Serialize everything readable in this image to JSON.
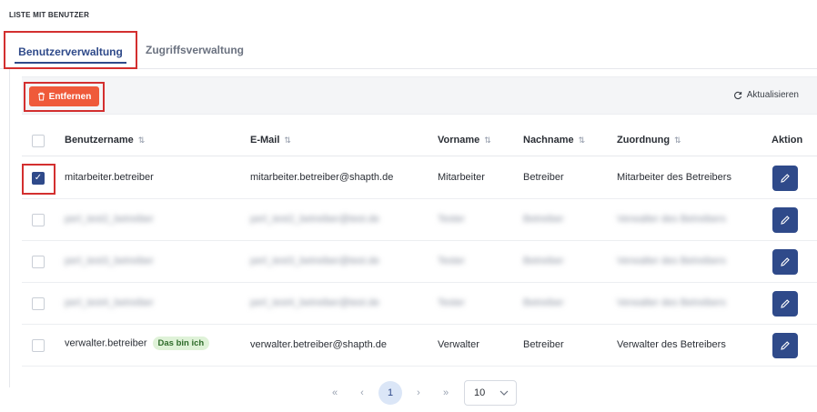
{
  "page_title": "LISTE MIT BENUTZER",
  "tabs": [
    {
      "label": "Benutzerverwaltung",
      "active": true
    },
    {
      "label": "Zugriffsverwaltung",
      "active": false
    }
  ],
  "toolbar": {
    "remove_label": "Entfernen",
    "refresh_label": "Aktualisieren"
  },
  "table": {
    "headers": {
      "username": "Benutzername",
      "email": "E-Mail",
      "firstname": "Vorname",
      "lastname": "Nachname",
      "assignment": "Zuordnung",
      "action": "Aktion"
    },
    "rows": [
      {
        "username": "mitarbeiter.betreiber",
        "email": "mitarbeiter.betreiber@shapth.de",
        "firstname": "Mitarbeiter",
        "lastname": "Betreiber",
        "assignment": "Mitarbeiter des Betreibers",
        "checked": true,
        "blurred": false
      },
      {
        "username": "perl_test2_betreiber",
        "email": "perl_test2_betreiber@test.de",
        "firstname": "Tester",
        "lastname": "Betreiber",
        "assignment": "Verwalter des Betreibers",
        "checked": false,
        "blurred": true
      },
      {
        "username": "perl_test3_betreiber",
        "email": "perl_test3_betreiber@test.de",
        "firstname": "Tester",
        "lastname": "Betreiber",
        "assignment": "Verwalter des Betreibers",
        "checked": false,
        "blurred": true
      },
      {
        "username": "perl_test4_betreiber",
        "email": "perl_test4_betreiber@test.de",
        "firstname": "Tester",
        "lastname": "Betreiber",
        "assignment": "Verwalter des Betreibers",
        "checked": false,
        "blurred": true
      },
      {
        "username": "verwalter.betreiber",
        "badge": "Das bin ich",
        "email": "verwalter.betreiber@shapth.de",
        "firstname": "Verwalter",
        "lastname": "Betreiber",
        "assignment": "Verwalter des Betreibers",
        "checked": false,
        "blurred": false
      }
    ]
  },
  "pagination": {
    "first": "«",
    "prev": "‹",
    "current_page": "1",
    "next": "›",
    "last": "»",
    "page_size": "10"
  },
  "colors": {
    "accent": "#2f4a8a",
    "danger": "#ef5a3a",
    "highlight": "#d32f2f"
  }
}
